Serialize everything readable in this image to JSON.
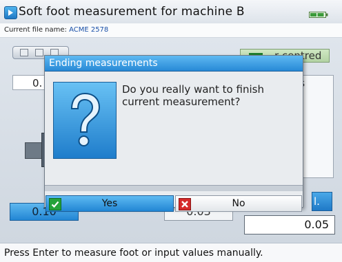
{
  "window": {
    "title": "Soft foot measurement for machine B",
    "app_icon": "arrow-right-icon",
    "status_icon": "battery-icon"
  },
  "file": {
    "label": "Current file name: ",
    "value": "ACME 2578"
  },
  "background": {
    "green_label": "…r centred",
    "left_value": "0.",
    "right_panel_text": "as",
    "right_blue_text": "l.",
    "values": {
      "left": "0.10",
      "middle": "0.03",
      "right": "0.05"
    }
  },
  "dialog": {
    "title": "Ending measurements",
    "message": "Do you really want to finish current measurement?",
    "icon": "question-mark-icon",
    "yes_label": "Yes",
    "no_label": "No",
    "yes_icon": "checkmark-icon",
    "no_icon": "close-icon"
  },
  "status": {
    "text": "Press Enter to measure foot or input values manually."
  },
  "colors": {
    "accent_blue": "#2286d4",
    "title_blue": "#2789d6",
    "yes_green": "#23a23a",
    "no_red": "#d52a2a"
  }
}
